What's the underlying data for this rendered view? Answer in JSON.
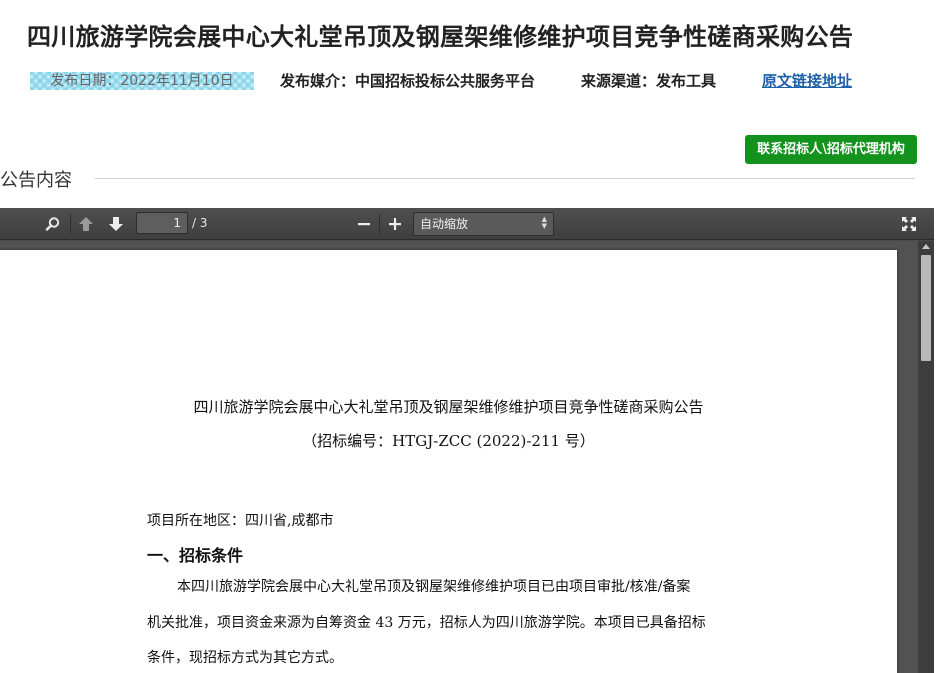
{
  "header": {
    "title": "四川旅游学院会展中心大礼堂吊顶及钢屋架维修维护项目竞争性磋商采购公告",
    "publish_date": "发布日期：2022年11月10日",
    "media": "发布媒介：中国招标投标公共服务平台",
    "source": "来源渠道：发布工具",
    "source_link": "原文链接地址"
  },
  "actions": {
    "contact_button": "联系招标人\\招标代理机构"
  },
  "section": {
    "heading": "公告内容"
  },
  "viewer": {
    "current_page": "1",
    "page_count": "/ 3",
    "zoom_label": "自动缩放",
    "icons": [
      "search-icon",
      "prev-page-icon",
      "next-page-icon",
      "zoom-out-icon",
      "zoom-in-icon",
      "fullscreen-icon"
    ]
  },
  "document": {
    "title": "四川旅游学院会展中心大礼堂吊顶及钢屋架维修维护项目竞争性磋商采购公告",
    "number": "（招标编号：HTGJ-ZCC (2022)-211 号）",
    "region": "项目所在地区：四川省,成都市",
    "section1_heading": "一、招标条件",
    "paragraph_lines": [
      "本四川旅游学院会展中心大礼堂吊顶及钢屋架维修维护项目已由项目审批/核准/备案",
      "机关批准，项目资金来源为自筹资金 43 万元，招标人为四川旅游学院。本项目已具备招标",
      "条件，现招标方式为其它方式。"
    ]
  },
  "colors": {
    "button_green": "#13921d",
    "link_blue": "#1d5fa8",
    "toolbar_dark": "#474747"
  }
}
